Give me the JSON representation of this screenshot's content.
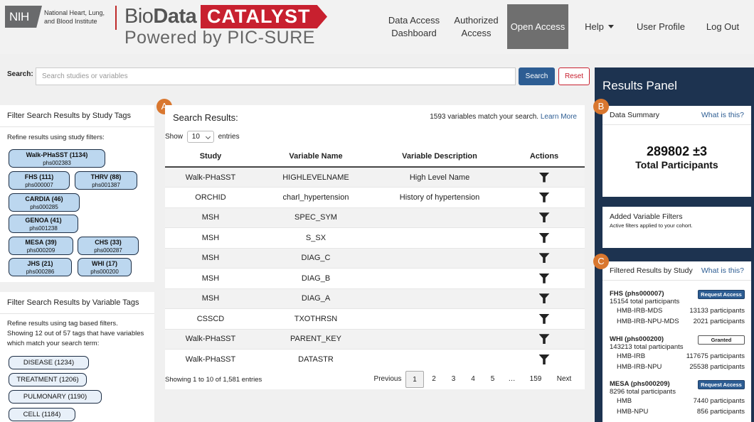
{
  "header": {
    "nih_logo": "NIH",
    "nih_name": "National Heart, Lung, and Blood Institute",
    "brand_bio": "Bio",
    "brand_data": "Data",
    "brand_catalyst": "CATALYST",
    "brand_powered": "Powered by PIC-SURE",
    "nav": {
      "data_access_1": "Data Access",
      "data_access_2": "Dashboard",
      "authorized_1": "Authorized",
      "authorized_2": "Access",
      "open_access": "Open Access",
      "help": "Help",
      "user_profile": "User Profile",
      "logout": "Log Out"
    }
  },
  "search": {
    "label": "Search:",
    "placeholder": "Search studies or variables",
    "search_button": "Search",
    "reset_button": "Reset"
  },
  "study_tags": {
    "title": "Filter Search Results by Study Tags",
    "subtitle": "Refine results using study filters:",
    "tags": [
      {
        "name": "Walk-PHaSST (1134)",
        "id": "phs002383"
      },
      {
        "name": "FHS (111)",
        "id": "phs000007"
      },
      {
        "name": "THRV (88)",
        "id": "phs001387"
      },
      {
        "name": "CARDIA (46)",
        "id": "phs000285"
      },
      {
        "name": "GENOA (41)",
        "id": "phs001238"
      },
      {
        "name": "MESA (39)",
        "id": "phs000209"
      },
      {
        "name": "CHS (33)",
        "id": "phs000287"
      },
      {
        "name": "JHS (21)",
        "id": "phs000286"
      },
      {
        "name": "WHI (17)",
        "id": "phs000200"
      }
    ]
  },
  "variable_tags": {
    "title": "Filter Search Results by Variable Tags",
    "line1": "Refine results using tag based filters.",
    "line2": "Showing 12 out of 57 tags that have variables",
    "line3": "which match your search term:",
    "tags": [
      "DISEASE (1234)",
      "TREATMENT (1206)",
      "PULMONARY (1190)",
      "CELL (1184)"
    ]
  },
  "results": {
    "badge": "A",
    "title": "Search Results:",
    "count_text": "1593 variables match your search.",
    "learn_more": "Learn More",
    "show_label": "Show",
    "show_value": "10",
    "entries_label": "entries",
    "columns": [
      "Study",
      "Variable Name",
      "Variable Description",
      "Actions"
    ],
    "rows": [
      {
        "study": "Walk-PHaSST",
        "var": "HIGHLEVELNAME",
        "desc": "High Level Name"
      },
      {
        "study": "ORCHID",
        "var": "charl_hypertension",
        "desc": "History of hypertension"
      },
      {
        "study": "MSH",
        "var": "SPEC_SYM",
        "desc": ""
      },
      {
        "study": "MSH",
        "var": "S_SX",
        "desc": ""
      },
      {
        "study": "MSH",
        "var": "DIAG_C",
        "desc": ""
      },
      {
        "study": "MSH",
        "var": "DIAG_B",
        "desc": ""
      },
      {
        "study": "MSH",
        "var": "DIAG_A",
        "desc": ""
      },
      {
        "study": "CSSCD",
        "var": "TXOTHRSN",
        "desc": ""
      },
      {
        "study": "Walk-PHaSST",
        "var": "PARENT_KEY",
        "desc": ""
      },
      {
        "study": "Walk-PHaSST",
        "var": "DATASTR",
        "desc": ""
      }
    ],
    "showing_info": "Showing 1 to 10 of 1,581 entries",
    "pager": [
      "Previous",
      "1",
      "2",
      "3",
      "4",
      "5",
      "…",
      "159",
      "Next"
    ]
  },
  "results_panel": {
    "title": "Results Panel",
    "data_summary": {
      "badge": "B",
      "title": "Data Summary",
      "link": "What is this?",
      "total": "289802 ±3",
      "total_label": "Total Participants"
    },
    "added_filters": {
      "title": "Added Variable Filters",
      "subtitle": "Active filters applied to your cohort."
    },
    "filtered": {
      "badge": "C",
      "title": "Filtered Results by Study",
      "link": "What is this?",
      "studies": [
        {
          "name": "FHS (phs000007)",
          "total": "15154 total participants",
          "button": "Request Access",
          "consents": [
            {
              "c": "HMB-IRB-MDS",
              "n": "13133 participants"
            },
            {
              "c": "HMB-IRB-NPU-MDS",
              "n": "2021 participants"
            }
          ]
        },
        {
          "name": "WHI (phs000200)",
          "total": "143213 total participants",
          "button": "Granted",
          "consents": [
            {
              "c": "HMB-IRB",
              "n": "117675 participants"
            },
            {
              "c": "HMB-IRB-NPU",
              "n": "25538 participants"
            }
          ]
        },
        {
          "name": "MESA (phs000209)",
          "total": "8296 total participants",
          "button": "Request Access",
          "consents": [
            {
              "c": "HMB",
              "n": "7440 participants"
            },
            {
              "c": "HMB-NPU",
              "n": "856 participants"
            }
          ]
        }
      ]
    }
  },
  "colors": {
    "brand_red": "#c8202f",
    "primary_blue": "#2d5d93",
    "panel_navy": "#1d3350",
    "badge_orange": "#d9772f",
    "tag_blue": "#bcd7ef"
  }
}
